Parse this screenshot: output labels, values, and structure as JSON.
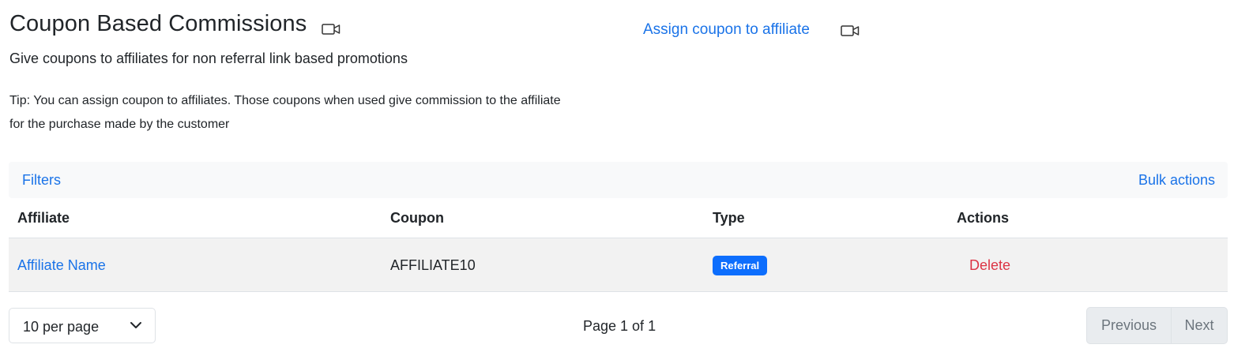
{
  "header": {
    "title": "Coupon Based Commissions",
    "title_icon": "video-camera-icon",
    "subtitle": "Give coupons to affiliates for non referral link based promotions",
    "tip": "Tip: You can assign coupon to affiliates. Those coupons when used give commission to the affiliate for the purchase made by the customer",
    "assign_link": "Assign coupon to affiliate",
    "assign_icon": "video-camera-icon"
  },
  "toolbar": {
    "filters": "Filters",
    "bulk_actions": "Bulk actions"
  },
  "table": {
    "columns": [
      "Affiliate",
      "Coupon",
      "Type",
      "Actions"
    ],
    "rows": [
      {
        "affiliate": "Affiliate Name",
        "coupon": "AFFILIATE10",
        "type": "Referral",
        "action": "Delete"
      }
    ]
  },
  "pagination": {
    "per_page": "10 per page",
    "page_info": "Page 1 of 1",
    "previous": "Previous",
    "next": "Next"
  },
  "colors": {
    "link": "#1a73e8",
    "badge": "#0d6efd",
    "danger": "#dc3545",
    "row_bg": "#f2f2f2"
  }
}
